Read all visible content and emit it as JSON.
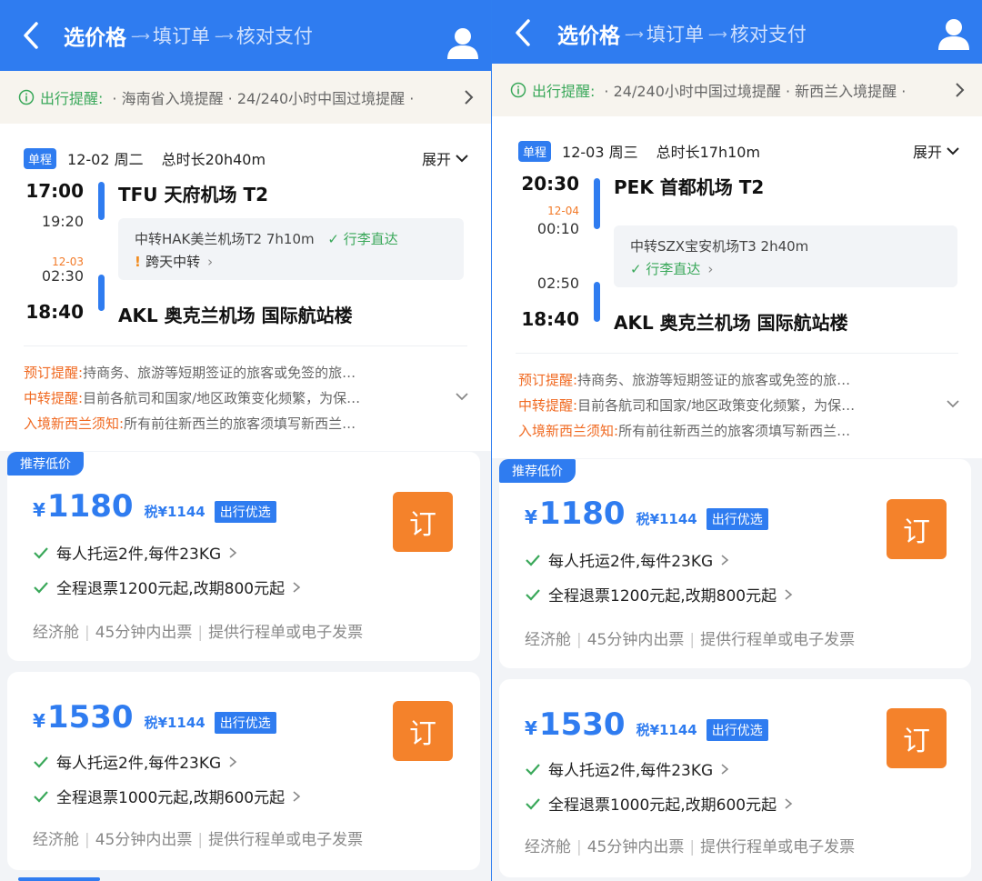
{
  "header": {
    "step1": "选价格",
    "step2": "填订单",
    "step3": "核对支付"
  },
  "colors": {
    "primary": "#2f7cf0",
    "accent": "#f4822b",
    "success": "#3aa85a",
    "warn": "#f06a22"
  },
  "left": {
    "notice": {
      "label": "出行提醒:",
      "items": "· 海南省入境提醒 · 24/240小时中国过境提醒 ·"
    },
    "trip": {
      "badge": "单程",
      "date": "12-02 周二",
      "duration": "总时长20h40m",
      "expand": "展开"
    },
    "dep_time": "17:00",
    "dep_airport": "TFU 天府机场 T2",
    "seg1_arr": "19:20",
    "transfer": {
      "text": "中转HAK美兰机场T2 7h10m",
      "baggage": "行李直达",
      "cross_day": "跨天中转"
    },
    "seg2_nextday": "12-03",
    "seg2_dep": "02:30",
    "arr_time": "18:40",
    "arr_airport": "AKL 奥克兰机场 国际航站楼",
    "reminders": [
      {
        "label": "预订提醒:",
        "text": "持商务、旅游等短期签证的旅客或免签的旅…"
      },
      {
        "label": "中转提醒:",
        "text": "目前各航司和国家/地区政策变化频繁，为保…"
      },
      {
        "label": "入境新西兰须知:",
        "text": "所有前往新西兰的旅客须填写新西兰…"
      }
    ]
  },
  "right": {
    "notice": {
      "label": "出行提醒:",
      "items": "· 24/240小时中国过境提醒 · 新西兰入境提醒 ·"
    },
    "trip": {
      "badge": "单程",
      "date": "12-03 周三",
      "duration": "总时长17h10m",
      "expand": "展开"
    },
    "dep_time": "20:30",
    "dep_airport": "PEK 首都机场 T2",
    "seg1_nextday": "12-04",
    "seg1_arr": "00:10",
    "transfer": {
      "text": "中转SZX宝安机场T3 2h40m",
      "baggage": "行李直达"
    },
    "seg2_dep": "02:50",
    "arr_time": "18:40",
    "arr_airport": "AKL 奥克兰机场 国际航站楼",
    "reminders": [
      {
        "label": "预订提醒:",
        "text": "持商务、旅游等短期签证的旅客或免签的旅…"
      },
      {
        "label": "中转提醒:",
        "text": "目前各航司和国家/地区政策变化频繁，为保…"
      },
      {
        "label": "入境新西兰须知:",
        "text": "所有前往新西兰的旅客须填写新西兰…"
      }
    ]
  },
  "offers": [
    {
      "badge": "推荐低价",
      "currency": "¥",
      "price": "1180",
      "tax": "税¥1144",
      "tag": "出行优选",
      "book": "订",
      "baggage": "每人托运2件,每件23KG",
      "refund": "全程退票1200元起,改期800元起",
      "cabin": "经济舱",
      "issue": "45分钟内出票",
      "invoice": "提供行程单或电子发票"
    },
    {
      "currency": "¥",
      "price": "1530",
      "tax": "税¥1144",
      "tag": "出行优选",
      "book": "订",
      "baggage": "每人托运2件,每件23KG",
      "refund": "全程退票1000元起,改期600元起",
      "cabin": "经济舱",
      "issue": "45分钟内出票",
      "invoice": "提供行程单或电子发票"
    }
  ]
}
